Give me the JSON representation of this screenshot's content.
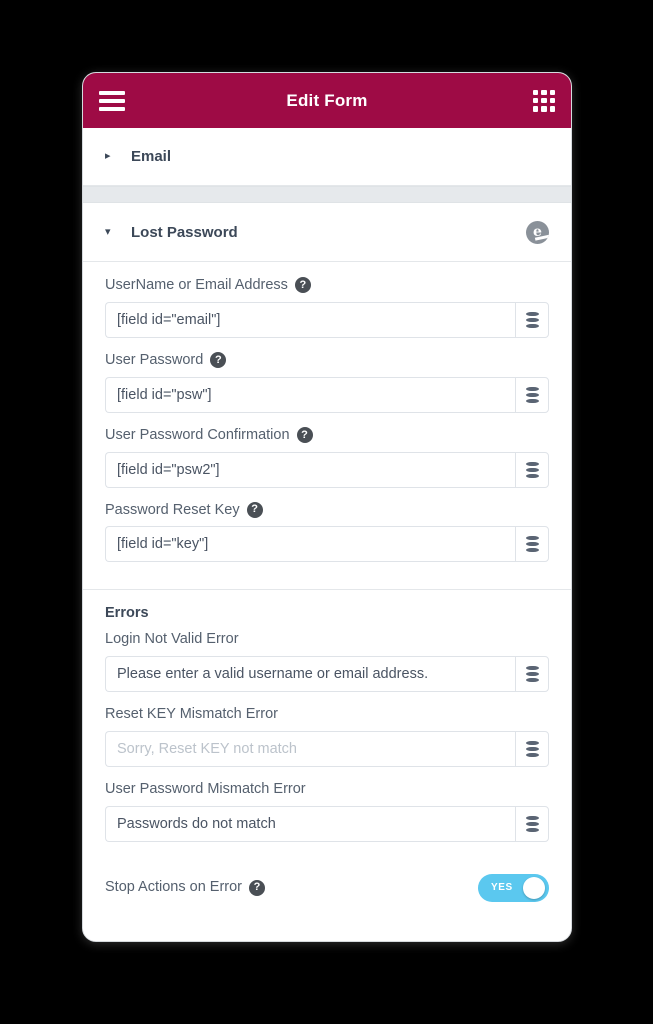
{
  "topbar": {
    "title": "Edit Form",
    "menu_icon": "hamburger-icon",
    "grid_icon": "grid-icon",
    "bg_color": "#9e0b45"
  },
  "sections": [
    {
      "title": "Email",
      "caret": "▸",
      "expanded": false
    },
    {
      "title": "Lost Password",
      "caret": "▾",
      "expanded": true,
      "badge": "e"
    }
  ],
  "form": {
    "fields": [
      {
        "label": "UserName or Email Address",
        "help": "?",
        "value": "[field id=\"email\"]",
        "is_placeholder": false,
        "action_icon": "database-icon"
      },
      {
        "label": "User Password",
        "help": "?",
        "value": "[field id=\"psw\"]",
        "is_placeholder": false,
        "action_icon": "database-icon"
      },
      {
        "label": "User Password Confirmation",
        "help": "?",
        "value": "[field id=\"psw2\"]",
        "is_placeholder": false,
        "action_icon": "database-icon"
      },
      {
        "label": "Password Reset Key",
        "help": "?",
        "value": "[field id=\"key\"]",
        "is_placeholder": false,
        "action_icon": "database-icon"
      }
    ]
  },
  "errors": {
    "heading": "Errors",
    "fields": [
      {
        "label": "Login Not Valid Error",
        "value": "Please enter a valid username or email address.",
        "is_placeholder": false,
        "action_icon": "database-icon"
      },
      {
        "label": "Reset KEY Mismatch Error",
        "value": "Sorry, Reset KEY not match",
        "is_placeholder": true,
        "action_icon": "database-icon"
      },
      {
        "label": "User Password Mismatch Error",
        "value": "Passwords do not match",
        "is_placeholder": false,
        "action_icon": "database-icon"
      }
    ]
  },
  "stop_actions": {
    "label": "Stop Actions on Error",
    "help": "?",
    "toggle_state": "YES",
    "toggle_on": true,
    "toggle_color": "#5bc8ef"
  }
}
